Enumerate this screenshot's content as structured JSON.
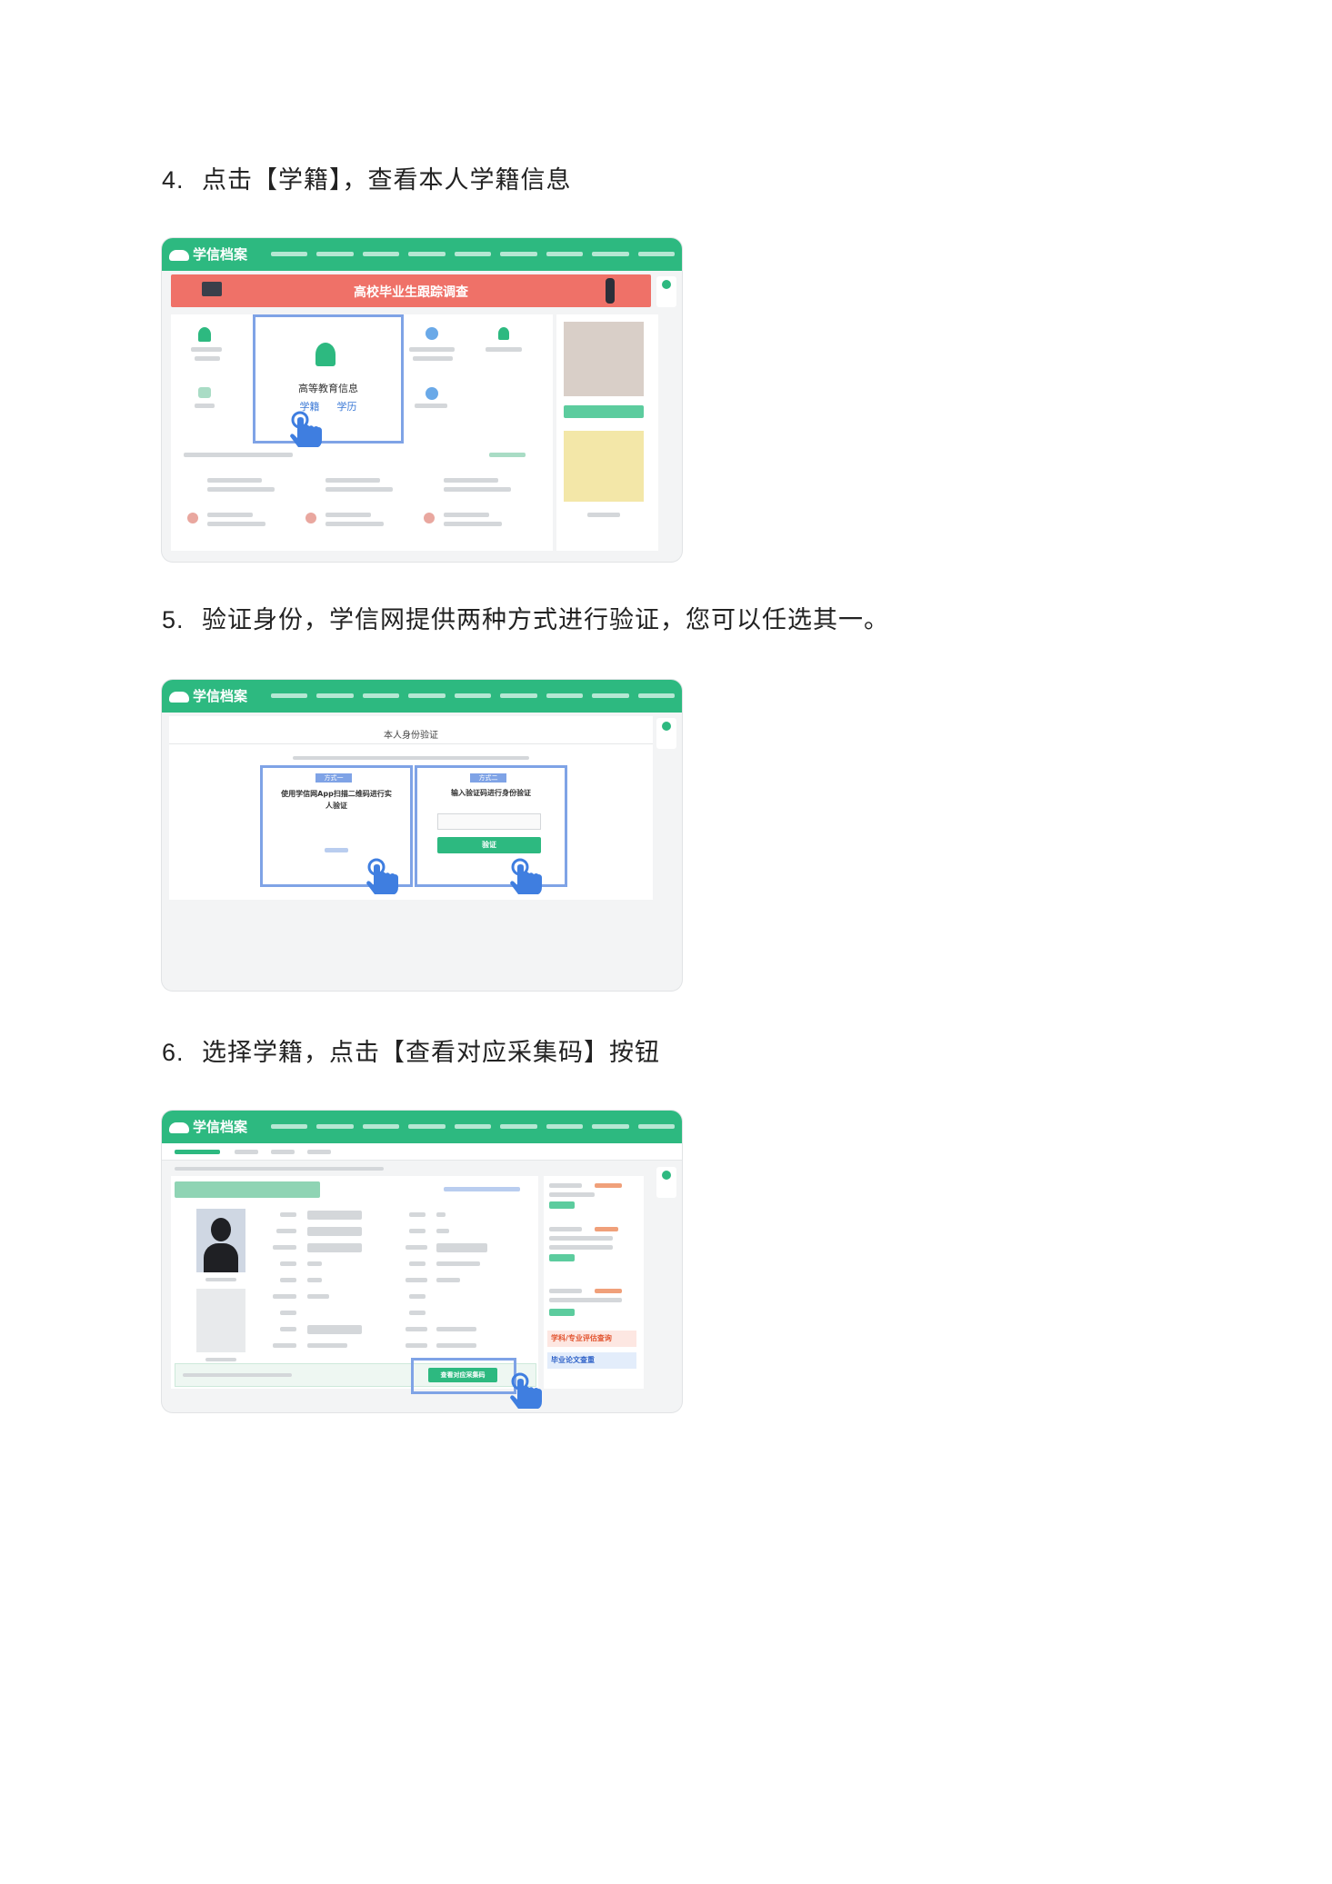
{
  "steps": [
    {
      "number": "4.",
      "text": "点击【学籍】，查看本人学籍信息",
      "screenshot": {
        "logo_text": "学信档案",
        "banner_title": "高校毕业生跟踪调查",
        "card_title": "高等教育信息",
        "card_link_1": "学籍",
        "card_link_2": "学历"
      }
    },
    {
      "number": "5.",
      "text": "验证身份，学信网提供两种方式进行验证，您可以任选其一。",
      "screenshot": {
        "logo_text": "学信档案",
        "page_title": "本人身份验证",
        "option_1_badge": "方式一",
        "option_1_title": "使用学信网App扫描二维码进行实人验证",
        "option_2_badge": "方式二",
        "option_2_title": "输入验证码进行身份验证",
        "option_2_button": "验证"
      }
    },
    {
      "number": "6.",
      "text": "选择学籍，点击【查看对应采集码】按钮",
      "screenshot": {
        "logo_text": "学信档案",
        "collect_button": "查看对应采集码",
        "promo_1": "学科/专业评估查询",
        "promo_2": "毕业论文查重"
      }
    }
  ],
  "colors": {
    "brand_green": "#2db980",
    "banner_red": "#ef7168",
    "highlight_blue": "#7fa3e6",
    "hand_blue": "#3f7ee0"
  }
}
